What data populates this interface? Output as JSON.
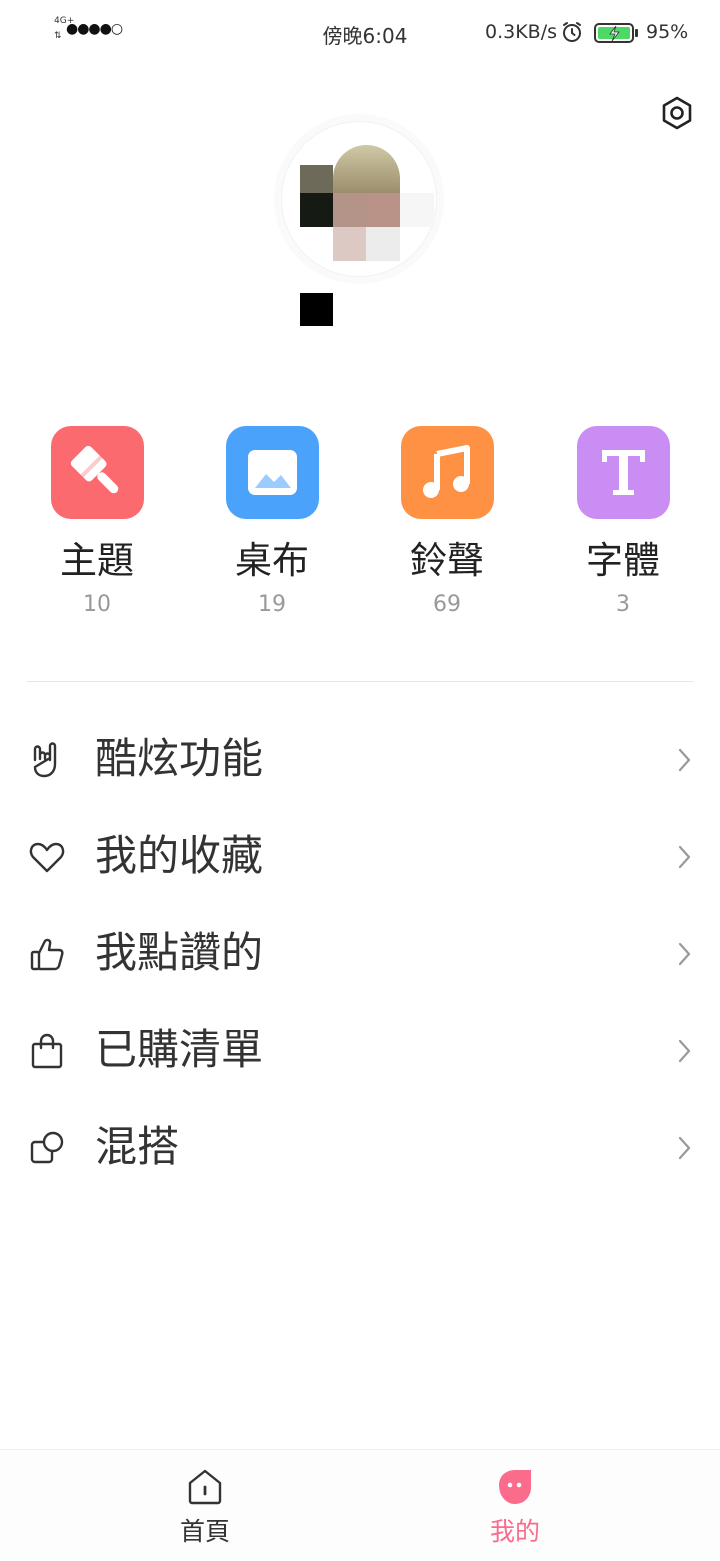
{
  "status_bar": {
    "network": "4G+",
    "arrows": "⇅",
    "signal": "●●●●○",
    "time": "傍晚6:04",
    "net_speed": "0.3KB/s",
    "battery": "95%"
  },
  "categories": [
    {
      "label": "主題",
      "count": "10",
      "color": "#fb6a6e",
      "icon": "paintbrush-icon"
    },
    {
      "label": "桌布",
      "count": "19",
      "color": "#4aa2fb",
      "icon": "image-icon"
    },
    {
      "label": "鈴聲",
      "count": "69",
      "color": "#fe9143",
      "icon": "music-note-icon"
    },
    {
      "label": "字體",
      "count": "3",
      "color": "#c98df4",
      "icon": "font-t-icon"
    }
  ],
  "menu": [
    {
      "label": "酷炫功能",
      "icon": "hand-gesture-icon"
    },
    {
      "label": "我的收藏",
      "icon": "heart-icon"
    },
    {
      "label": "我點讚的",
      "icon": "thumbs-up-icon"
    },
    {
      "label": "已購清單",
      "icon": "shopping-bag-icon"
    },
    {
      "label": "混搭",
      "icon": "shapes-icon"
    }
  ],
  "bottom_nav": {
    "home_label": "首頁",
    "me_label": "我的",
    "active_color": "#fb6b8c",
    "inactive_color": "#333333"
  }
}
